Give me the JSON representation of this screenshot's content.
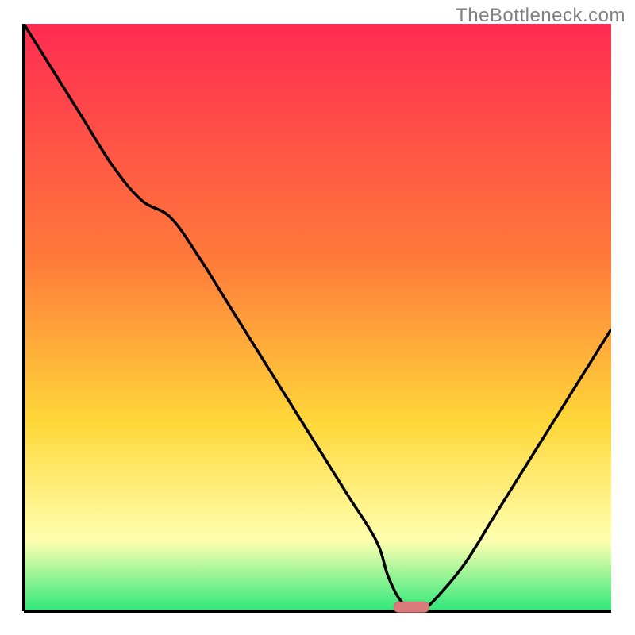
{
  "watermark": "TheBottleneck.com",
  "colors": {
    "gradient_top": "#ff2b52",
    "gradient_mid1": "#ff7a3a",
    "gradient_mid2": "#ffd83a",
    "gradient_pale": "#ffffb0",
    "gradient_bottom": "#2ee87a",
    "axis": "#000000",
    "curve": "#000000",
    "marker_fill": "#d97b7b",
    "marker_stroke": "#c86a6a"
  },
  "chart_data": {
    "type": "line",
    "title": "",
    "xlabel": "",
    "ylabel": "",
    "xlim": [
      0,
      100
    ],
    "ylim": [
      0,
      100
    ],
    "x": [
      0,
      5,
      10,
      15,
      20,
      25,
      30,
      35,
      40,
      45,
      50,
      55,
      60,
      62,
      64,
      66,
      68,
      70,
      75,
      80,
      85,
      90,
      95,
      100
    ],
    "values": [
      100,
      92,
      84,
      76,
      70,
      67,
      60,
      52,
      44,
      36,
      28,
      20,
      12,
      6,
      2,
      0.5,
      0.5,
      2,
      8,
      16,
      24,
      32,
      40,
      48
    ],
    "marker_center_x": 66,
    "marker_width_x": 6,
    "marker_y": 0.7
  }
}
